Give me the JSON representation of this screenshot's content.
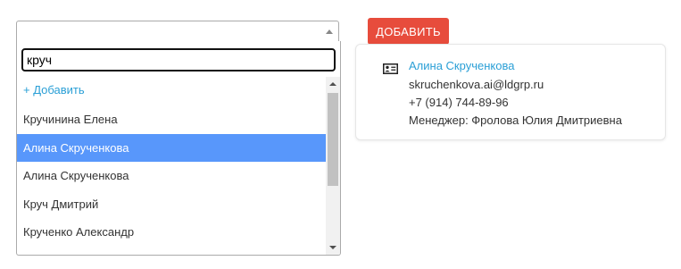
{
  "select": {
    "selected_value": "",
    "search_value": "круч",
    "add_option_label": "+ Добавить",
    "options": [
      {
        "label": "Кручинина Елена",
        "highlighted": false
      },
      {
        "label": "Алина Скрученкова",
        "highlighted": true
      },
      {
        "label": "Алина Скрученкова",
        "highlighted": false
      },
      {
        "label": "Круч Дмитрий",
        "highlighted": false
      },
      {
        "label": "Крученко Александр",
        "highlighted": false
      }
    ]
  },
  "add_button": {
    "label": "ДОБАВИТЬ"
  },
  "contact_card": {
    "icon": "contact-card-icon",
    "name": "Алина Скрученкова",
    "email": "skruchenkova.ai@ldgrp.ru",
    "phone": "+7 (914) 744-89-96",
    "manager": "Менеджер: Фролова Юлия Дмитриевна"
  },
  "colors": {
    "link": "#2a9fd6",
    "highlight": "#5897fb",
    "button": "#e74c3c"
  }
}
